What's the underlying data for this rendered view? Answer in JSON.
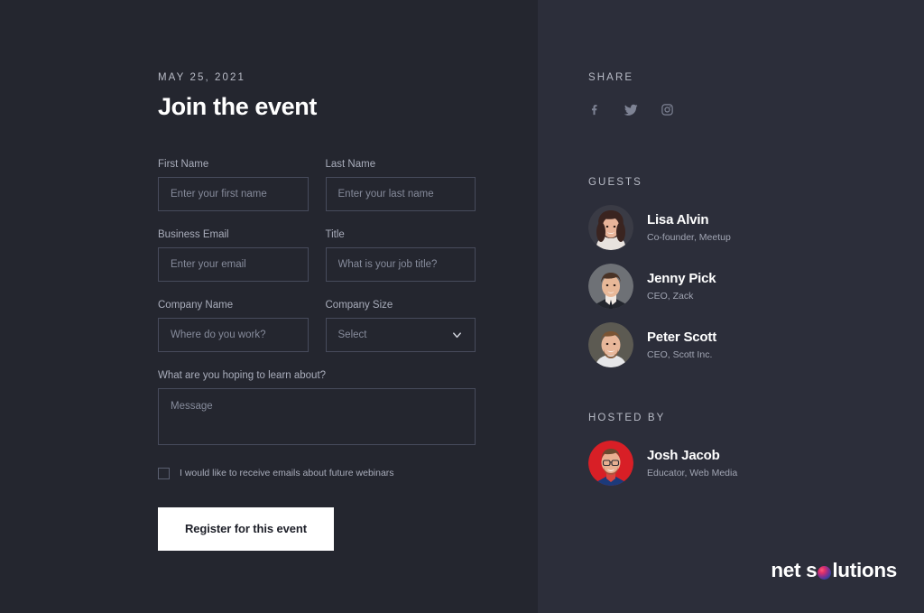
{
  "left": {
    "date": "MAY 25, 2021",
    "title": "Join the event",
    "fields": {
      "first_name": {
        "label": "First Name",
        "placeholder": "Enter your first name",
        "value": ""
      },
      "last_name": {
        "label": "Last Name",
        "placeholder": "Enter your last name",
        "value": ""
      },
      "business_email": {
        "label": "Business Email",
        "placeholder": "Enter your email",
        "value": ""
      },
      "title": {
        "label": "Title",
        "placeholder": "What is your job title?",
        "value": ""
      },
      "company_name": {
        "label": "Company Name",
        "placeholder": "Where do you work?",
        "value": ""
      },
      "company_size": {
        "label": "Company Size",
        "selected": "Select"
      },
      "message": {
        "label": "What are you hoping to learn about?",
        "placeholder": "Message",
        "value": ""
      }
    },
    "checkbox": {
      "label": "I would like to receive emails about future webinars",
      "checked": false
    },
    "submit_label": "Register for this event"
  },
  "right": {
    "share": {
      "heading": "SHARE",
      "icons": [
        "facebook-icon",
        "twitter-icon",
        "instagram-icon"
      ]
    },
    "guests": {
      "heading": "GUESTS",
      "people": [
        {
          "name": "Lisa Alvin",
          "role": "Co-founder, Meetup"
        },
        {
          "name": "Jenny Pick",
          "role": "CEO, Zack"
        },
        {
          "name": "Peter Scott",
          "role": "CEO, Scott Inc."
        }
      ]
    },
    "hosted_by": {
      "heading": "HOSTED BY",
      "people": [
        {
          "name": "Josh Jacob",
          "role": "Educator, Web Media"
        }
      ]
    }
  },
  "logo": {
    "text_before": "net s",
    "text_after": "lutions"
  },
  "colors": {
    "left_bg": "#24262f",
    "right_bg": "#2c2e3a",
    "accent_red": "#d81f26",
    "button_bg": "#ffffff",
    "border": "#474b5c",
    "muted_text": "#a9adbb"
  }
}
